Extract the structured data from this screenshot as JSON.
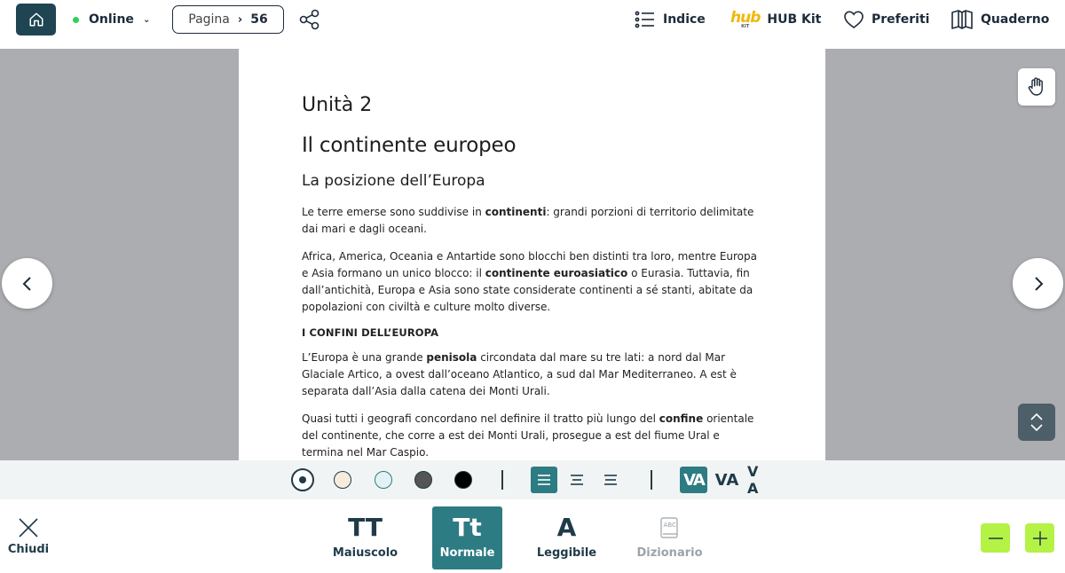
{
  "topbar": {
    "status_label": "Online",
    "status_color": "#2ed05c",
    "page_label": "Pagina",
    "page_number": "56",
    "nav": {
      "indice": "Indice",
      "hubkit": "HUB Kit",
      "hub_logo_text": "hub",
      "hub_logo_sub": "KIT",
      "preferiti": "Preferiti",
      "quaderno": "Quaderno"
    },
    "icons": [
      "home-icon",
      "chevron-down-icon",
      "chevron-right-icon",
      "share-icon",
      "list-icon",
      "heart-icon",
      "book-icon"
    ]
  },
  "content": {
    "unit": "Unità 2",
    "title": "Il continente europeo",
    "section": "La posizione dell’Europa",
    "p1": [
      {
        "t": "Le terre emerse sono suddivise in "
      },
      {
        "t": "continenti",
        "b": true
      },
      {
        "t": ": grandi porzioni di territorio delimitate dai mari e dagli oceani."
      }
    ],
    "p2": [
      {
        "t": "Africa, America, Oceania e Antartide sono blocchi ben distinti tra loro, mentre Europa e Asia formano un unico blocco: il "
      },
      {
        "t": "continente euroasiatico",
        "b": true
      },
      {
        "t": " o Eurasia. Tuttavia, fin dall’antichità, Europa e Asia sono state considerate continenti a sé stanti, abitate da popolazioni con civiltà e culture molto diverse."
      }
    ],
    "subhead": "I CONFINI DELL’EUROPA",
    "p3": [
      {
        "t": "L’Europa è una grande "
      },
      {
        "t": "penisola",
        "b": true
      },
      {
        "t": " circondata dal mare su tre lati: a nord dal Mar Glaciale Artico, a ovest dall’oceano Atlantico, a sud dal Mar Mediterraneo. A est è separata dall’Asia dalla catena dei Monti Urali."
      }
    ],
    "p4": [
      {
        "t": "Quasi tutti i geografi concordano nel definire il tratto più lungo del "
      },
      {
        "t": "confine",
        "b": true
      },
      {
        "t": " orientale del continente, che corre a est dei Monti Urali, prosegue a est del fiume Ural e termina nel Mar Caspio."
      }
    ]
  },
  "settings": {
    "background_colors": [
      "#ffffff",
      "#f6ecdc",
      "#e3f3f5",
      "#555555",
      "#000000"
    ],
    "selected_background": 0,
    "alignment": [
      "align-left",
      "align-center",
      "align-right"
    ],
    "selected_alignment": 0,
    "spacing": [
      "VA",
      "VA",
      "V A"
    ],
    "selected_spacing": 0
  },
  "bottombar": {
    "close_label": "Chiudi",
    "fonts": [
      {
        "glyph": "TT",
        "label": "Maiuscolo"
      },
      {
        "glyph": "Tt",
        "label": "Normale"
      },
      {
        "glyph": "A",
        "label": "Leggibile"
      },
      {
        "glyph": "",
        "label": "Dizionario"
      }
    ],
    "selected_font": 1,
    "dictionary_icon_text": "ABC",
    "accent_color": "#2d7b83",
    "zoom_color": "#b5f246"
  }
}
